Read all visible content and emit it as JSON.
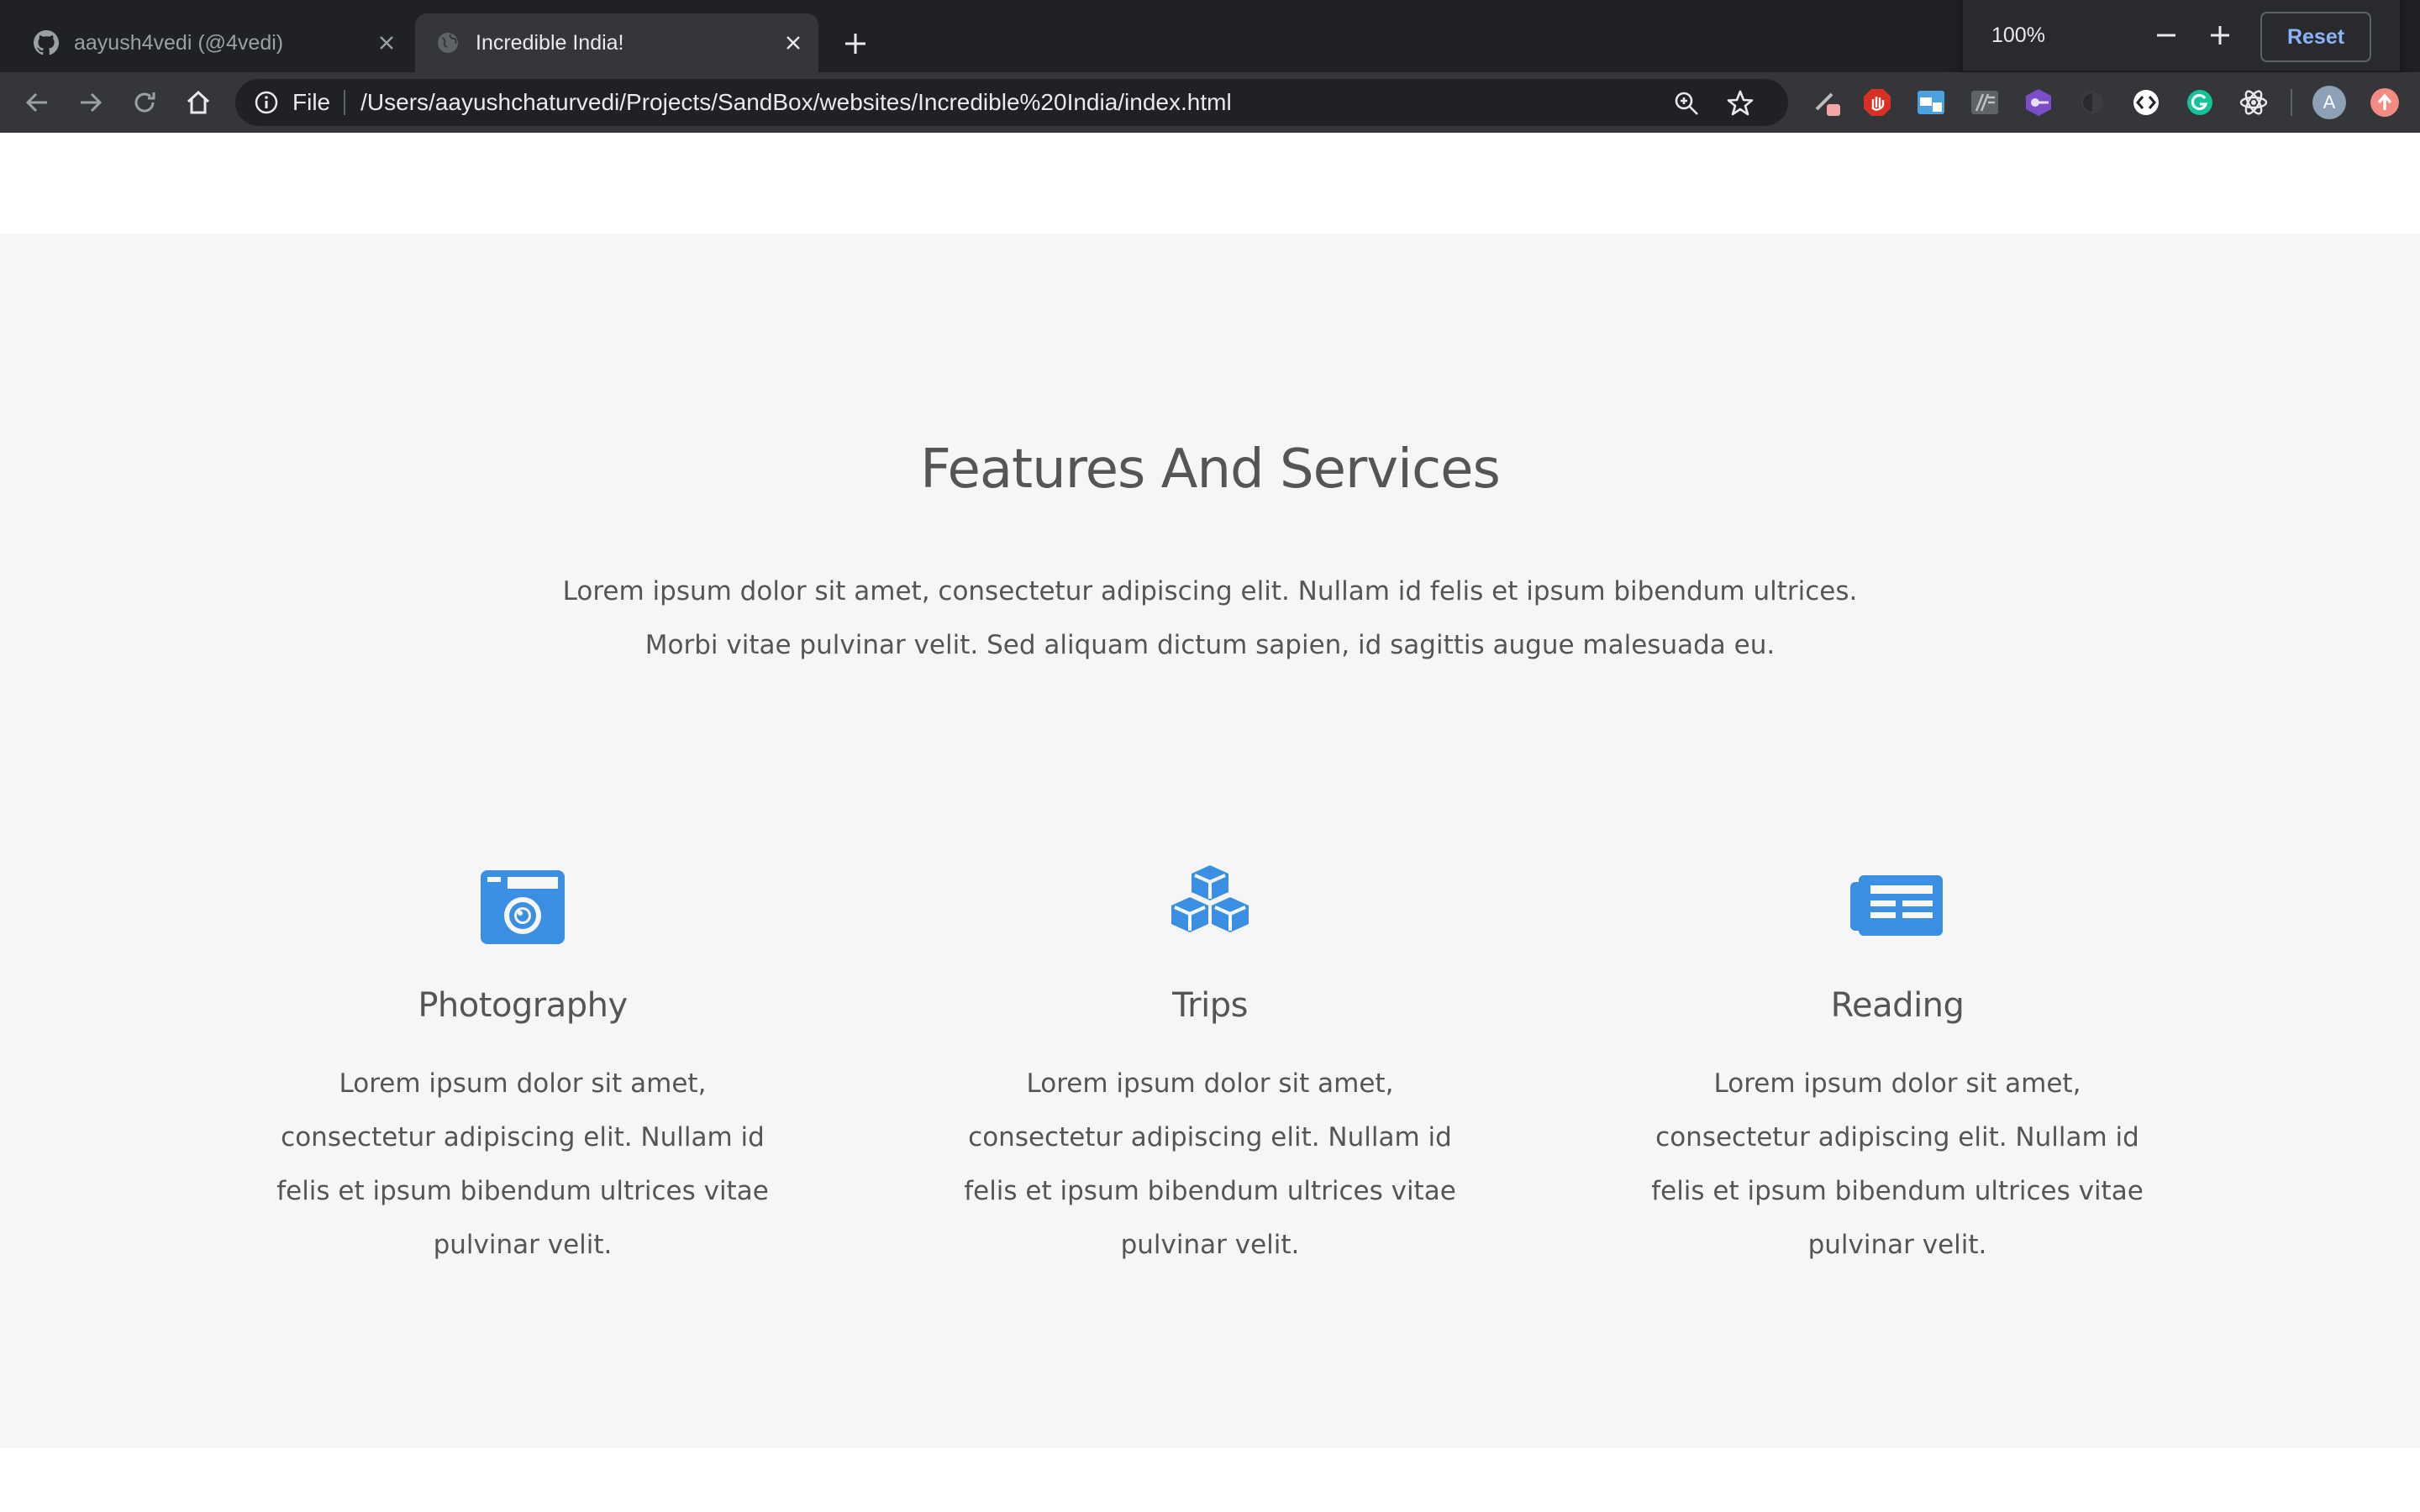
{
  "browser": {
    "tabs": [
      {
        "title": "aayush4vedi (@4vedi)",
        "favicon": "github-icon",
        "active": false
      },
      {
        "title": "Incredible India!",
        "favicon": "globe-icon",
        "active": true
      }
    ],
    "address": {
      "scheme": "File",
      "url": "/Users/aayushchaturvedi/Projects/SandBox/websites/Incredible%20India/index.html"
    },
    "zoom": {
      "value": "100%",
      "reset_label": "Reset"
    },
    "profile_initial": "A",
    "extensions": [
      "pen-extension-icon",
      "adblock-icon",
      "window-extension-icon",
      "reader-extension-icon",
      "purple-extension-icon",
      "dark-extension-icon",
      "code-extension-icon",
      "grammarly-icon",
      "react-devtools-icon"
    ]
  },
  "features": {
    "title": "Features And Services",
    "lead_line1": "Lorem ipsum dolor sit amet, consectetur adipiscing elit. Nullam id felis et ipsum bibendum ultrices.",
    "lead_line2": "Morbi vitae pulvinar velit. Sed aliquam dictum sapien, id sagittis augue malesuada eu.",
    "items": [
      {
        "icon": "camera-icon",
        "title": "Photography",
        "text": "Lorem ipsum dolor sit amet, consectetur adipiscing elit. Nullam id felis et ipsum bibendum ultrices vitae pulvinar velit."
      },
      {
        "icon": "cubes-icon",
        "title": "Trips",
        "text": "Lorem ipsum dolor sit amet, consectetur adipiscing elit. Nullam id felis et ipsum bibendum ultrices vitae pulvinar velit."
      },
      {
        "icon": "newspaper-icon",
        "title": "Reading",
        "text": "Lorem ipsum dolor sit amet, consectetur adipiscing elit. Nullam id felis et ipsum bibendum ultrices vitae pulvinar velit."
      }
    ]
  },
  "colors": {
    "accent": "#3b8fe3",
    "section_bg": "#f6f6f6",
    "text": "#555555",
    "chrome_dark": "#202124",
    "chrome_toolbar": "#35363a"
  }
}
